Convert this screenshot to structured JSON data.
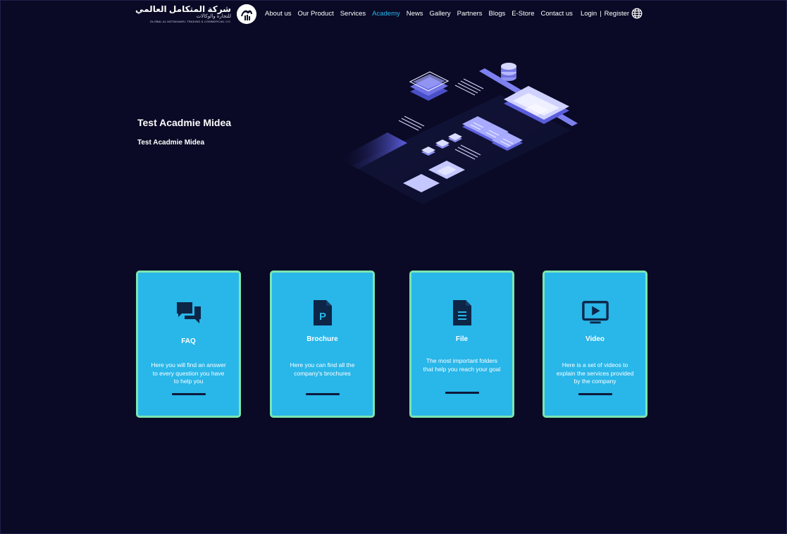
{
  "header": {
    "logo": {
      "arabic_title": "شركة المتكامل العالمي",
      "arabic_subtitle": "للتجارة والوكالات",
      "english_line": "GLOBAL AL MOTAKAMEL TRADING & COMMERCIAL CO."
    },
    "nav": [
      {
        "label": "About us",
        "active": false
      },
      {
        "label": "Our Product",
        "active": false
      },
      {
        "label": "Services",
        "active": false
      },
      {
        "label": "Academy",
        "active": true
      },
      {
        "label": "News",
        "active": false
      },
      {
        "label": "Gallery",
        "active": false
      },
      {
        "label": "Partners",
        "active": false
      },
      {
        "label": "Blogs",
        "active": false
      },
      {
        "label": "E-Store",
        "active": false
      },
      {
        "label": "Contact us",
        "active": false
      }
    ],
    "auth": {
      "login": "Login",
      "separator": "|",
      "register": "Register"
    },
    "language_icon": "globe-icon"
  },
  "hero": {
    "title": "Test Acadmie Midea",
    "subtitle": "Test Acadmie Midea"
  },
  "cards": [
    {
      "icon": "chat-bubbles-icon",
      "title": "FAQ",
      "description": "Here you will find an answer to every question you have to help you"
    },
    {
      "icon": "brochure-file-icon",
      "title": "Brochure",
      "description": "Here you can find all the company's brochures"
    },
    {
      "icon": "document-icon",
      "title": "File",
      "description": "The most important folders that help you reach your goal"
    },
    {
      "icon": "video-play-icon",
      "title": "Video",
      "description": "Here is a set of videos to explain the services provided by the company"
    }
  ],
  "colors": {
    "background": "#0a0a26",
    "accent_active_nav": "#29b8ec",
    "card_fill": "#29b6e9",
    "card_border": "#7be5b1",
    "icon_dark": "#0d2547"
  }
}
